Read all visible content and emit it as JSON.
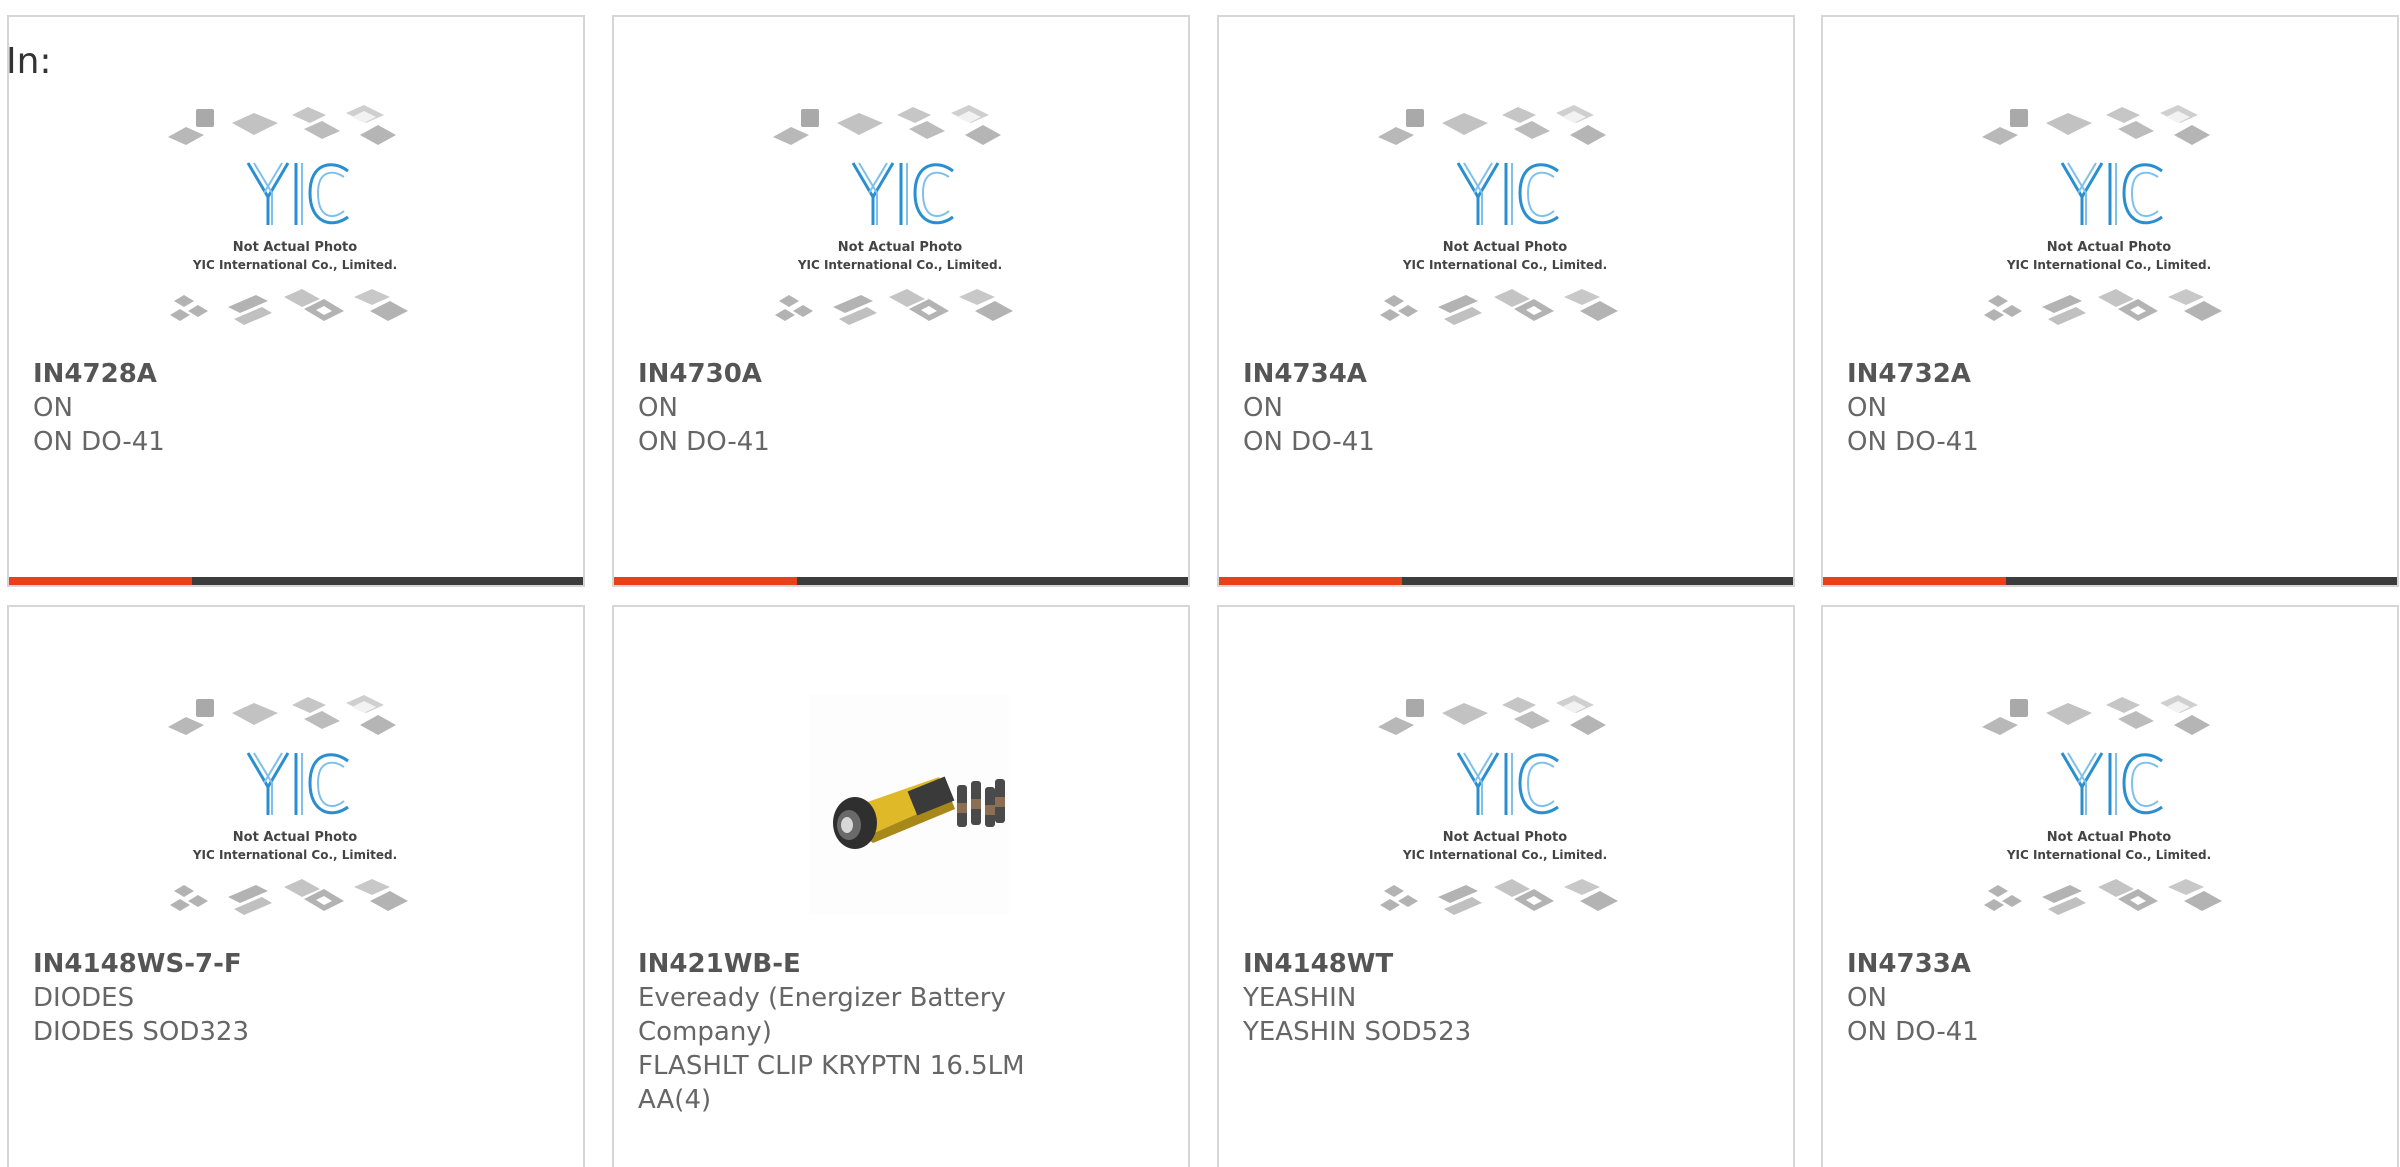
{
  "search": {
    "label": "In:"
  },
  "placeholder_image": {
    "line1": "Not Actual Photo",
    "line2": "YIC International Co., Limited.",
    "logo_text": "YIC",
    "accent_color": "#2a8fd0"
  },
  "colors": {
    "bar_accent": "#e8401c",
    "bar_dark": "#3c3c3c",
    "card_border": "#d6d6d6",
    "text": "#666666"
  },
  "products": [
    {
      "part": "IN4728A",
      "manufacturer": "ON",
      "description": "ON DO-41",
      "image": "placeholder-chip-icon"
    },
    {
      "part": "IN4730A",
      "manufacturer": "ON",
      "description": "ON DO-41",
      "image": "placeholder-chip-icon"
    },
    {
      "part": "IN4734A",
      "manufacturer": "ON",
      "description": "ON DO-41",
      "image": "placeholder-chip-icon"
    },
    {
      "part": "IN4732A",
      "manufacturer": "ON",
      "description": "ON DO-41",
      "image": "placeholder-chip-icon"
    },
    {
      "part": "IN4148WS-7-F",
      "manufacturer": "DIODES",
      "description": "DIODES SOD323",
      "image": "placeholder-chip-icon"
    },
    {
      "part": "IN421WB-E",
      "manufacturer": "Eveready (Energizer Battery Company)",
      "description": "FLASHLT CLIP KRYPTN 16.5LM AA(4)",
      "image": "flashlight-photo"
    },
    {
      "part": "IN4148WT",
      "manufacturer": "YEASHIN",
      "description": "YEASHIN SOD523",
      "image": "placeholder-chip-icon"
    },
    {
      "part": "IN4733A",
      "manufacturer": "ON",
      "description": "ON DO-41",
      "image": "placeholder-chip-icon"
    }
  ]
}
